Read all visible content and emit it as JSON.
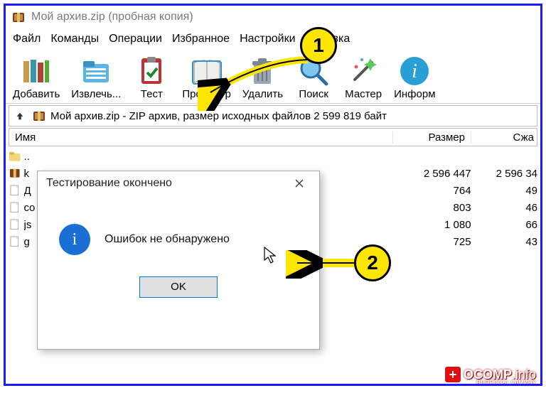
{
  "window": {
    "title": "Мой архив.zip (пробная копия)"
  },
  "menu": [
    "Файл",
    "Команды",
    "Операции",
    "Избранное",
    "Настройки",
    "Справка"
  ],
  "toolbar": [
    {
      "name": "add",
      "label": "Добавить"
    },
    {
      "name": "extract",
      "label": "Извлечь..."
    },
    {
      "name": "test",
      "label": "Тест"
    },
    {
      "name": "view",
      "label": "Просмотр"
    },
    {
      "name": "delete",
      "label": "Удалить"
    },
    {
      "name": "find",
      "label": "Поиск"
    },
    {
      "name": "wizard",
      "label": "Мастер"
    },
    {
      "name": "info",
      "label": "Информ"
    }
  ],
  "path_bar": "Мой архив.zip - ZIP архив, размер исходных файлов 2 599 819 байт",
  "columns": {
    "name": "Имя",
    "size": "Размер",
    "packed": "Сжа"
  },
  "rows": [
    {
      "icon": "updir",
      "name": "..",
      "size": "",
      "packed": ""
    },
    {
      "icon": "archive",
      "name": "k",
      "size": "2 596 447",
      "packed": "2 596 34"
    },
    {
      "icon": "file",
      "name": "Д",
      "size": "764",
      "packed": "49"
    },
    {
      "icon": "file",
      "name": "co",
      "size": "803",
      "packed": "46"
    },
    {
      "icon": "file",
      "name": "js",
      "size": "1 080",
      "packed": "66"
    },
    {
      "icon": "file",
      "name": "g",
      "size": "725",
      "packed": "43"
    }
  ],
  "dialog": {
    "title": "Тестирование окончено",
    "message": "Ошибок не обнаружено",
    "ok": "OK"
  },
  "callouts": {
    "one": "1",
    "two": "2"
  },
  "watermark": {
    "brand": "OCOMP",
    "suffix": ".info",
    "sub": "ВОПРОСЫ АДМИНУ"
  }
}
